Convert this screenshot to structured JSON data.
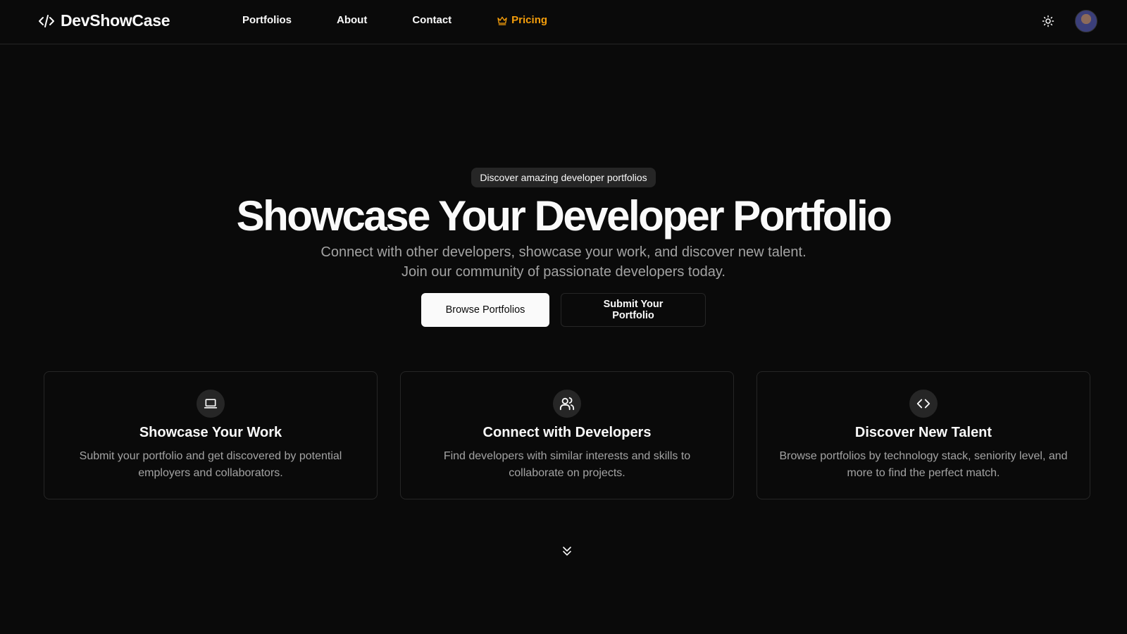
{
  "header": {
    "brand": "DevShowCase",
    "nav": {
      "portfolios": "Portfolios",
      "about": "About",
      "contact": "Contact",
      "pricing": "Pricing"
    },
    "accent_color": "#f59e0b"
  },
  "hero": {
    "badge": "Discover amazing developer portfolios",
    "title": "Showcase Your Developer Portfolio",
    "subtitle": "Connect with other developers, showcase your work, and discover new talent. Join our community of passionate developers today.",
    "primary_button": "Browse Portfolios",
    "secondary_button": "Submit Your Portfolio"
  },
  "features": [
    {
      "icon": "laptop-icon",
      "title": "Showcase Your Work",
      "description": "Submit your portfolio and get discovered by potential employers and collaborators."
    },
    {
      "icon": "users-icon",
      "title": "Connect with Developers",
      "description": "Find developers with similar interests and skills to collaborate on projects."
    },
    {
      "icon": "code-icon",
      "title": "Discover New Talent",
      "description": "Browse portfolios by technology stack, seniority level, and more to find the perfect match."
    }
  ],
  "icons": {
    "theme_toggle": "sun-icon",
    "scroll": "chevrons-down-icon"
  }
}
